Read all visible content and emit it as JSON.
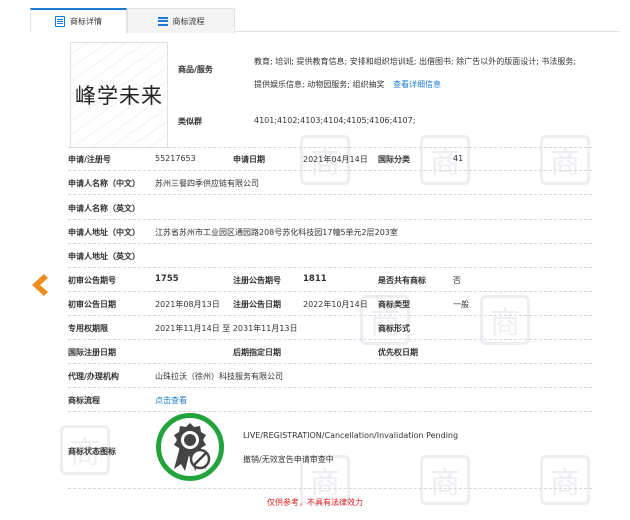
{
  "tabs": [
    {
      "label": "商标详情",
      "icon": "document-icon",
      "active": true
    },
    {
      "label": "商标流程",
      "icon": "list-icon",
      "active": false
    }
  ],
  "watermark_char": "商",
  "trademark": {
    "logo_text": "峰学未来",
    "goods_label": "商品/服务",
    "goods_text": "教育; 培训; 提供教育信息; 安排和组织培训班; 出借图书; 除广告以外的版面设计; 书法服务; 提供娱乐信息; 动物园服务; 组织抽奖",
    "goods_link": "查看详细信息",
    "similar_group_label": "类似群",
    "similar_group_value": "4101;4102;4103;4104;4105;4106;4107;"
  },
  "fields": {
    "reg_no_label": "申请/注册号",
    "reg_no": "55217653",
    "apply_date_label": "申请日期",
    "apply_date": "2021年04月14日",
    "intl_class_label": "国际分类",
    "intl_class": "41",
    "applicant_cn_label": "申请人名称（中文）",
    "applicant_cn": "苏州三餐四季供应链有限公司",
    "applicant_en_label": "申请人名称（英文）",
    "address_cn_label": "申请人地址（中文）",
    "address_cn": "江苏省苏州市工业园区通园路208号苏化科技园17幢5单元2层203室",
    "address_en_label": "申请人地址（英文）",
    "prelim_no_label": "初审公告期号",
    "prelim_no": "1755",
    "reg_notice_no_label": "注册公告期号",
    "reg_notice_no": "1811",
    "shared_label": "是否共有商标",
    "shared": "否",
    "prelim_date_label": "初审公告日期",
    "prelim_date": "2021年08月13日",
    "reg_notice_date_label": "注册公告日期",
    "reg_notice_date": "2022年10月14日",
    "type_label": "商标类型",
    "type": "一般",
    "exclusive_label": "专用权期限",
    "exclusive": "2021年11月14日 至 2031年11月13日",
    "form_label": "商标形式",
    "intl_reg_date_label": "国际注册日期",
    "later_date_label": "后期指定日期",
    "priority_label": "优先权日期",
    "agent_label": "代理/办理机构",
    "agent": "山珠拉沃（徐州）科技服务有限公司",
    "flow_label": "商标流程",
    "flow_link": "点击查看",
    "status_icon_label": "商标状态图标"
  },
  "status": {
    "en": "LIVE/REGISTRATION/Cancellation/Invalidation Pending",
    "cn": "撤销/无效宣告申请审查中",
    "badge_color": "#22a33b"
  },
  "disclaimer": "仅供参考，不具有法律效力",
  "colors": {
    "link": "#1a7bd6",
    "accent": "#1a7bd6",
    "arrow": "#f08c1e",
    "disclaimer": "#e02020"
  }
}
